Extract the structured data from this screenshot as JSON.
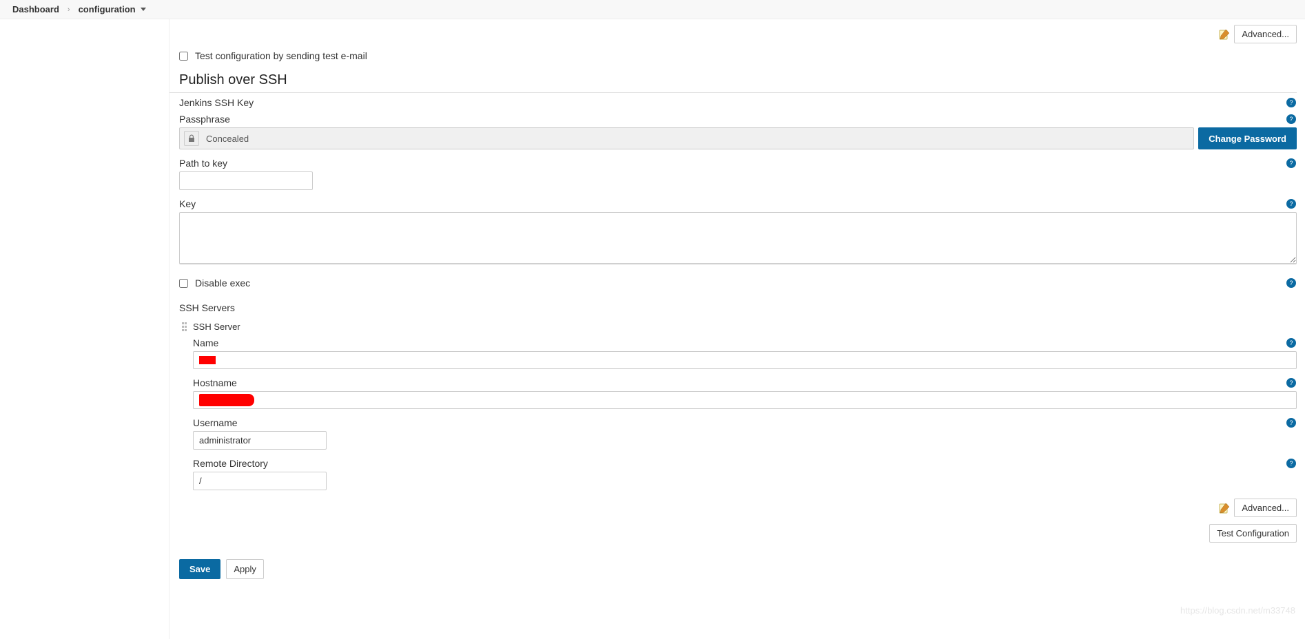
{
  "breadcrumb": {
    "dashboard": "Dashboard",
    "configuration": "configuration"
  },
  "top_actions": {
    "advanced": "Advanced..."
  },
  "email_test": {
    "checkbox_label": "Test configuration by sending test e-mail"
  },
  "ssh_section": {
    "title": "Publish over SSH",
    "jenkins_key_label": "Jenkins SSH Key",
    "passphrase_label": "Passphrase",
    "passphrase_value": "Concealed",
    "change_password": "Change Password",
    "path_label": "Path to key",
    "path_value": "",
    "key_label": "Key",
    "key_value": "",
    "disable_exec_label": "Disable exec",
    "servers_label": "SSH Servers"
  },
  "ssh_server": {
    "header": "SSH Server",
    "name_label": "Name",
    "name_value": "",
    "hostname_label": "Hostname",
    "hostname_value": "",
    "username_label": "Username",
    "username_value": "administrator",
    "remote_dir_label": "Remote Directory",
    "remote_dir_value": "/",
    "advanced": "Advanced...",
    "test_config": "Test Configuration"
  },
  "footer": {
    "save": "Save",
    "apply": "Apply"
  },
  "watermark": "https://blog.csdn.net/m33748"
}
